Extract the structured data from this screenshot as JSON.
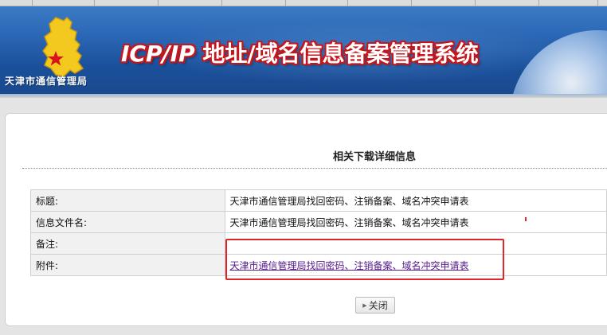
{
  "header": {
    "org_name": "天津市通信管理局",
    "system_title_latin": "ICP/IP",
    "system_title_rest": " 地址/域名信息备案管理系统",
    "logo_icon": "tianjin-map-star-icon",
    "accent_red": "#c4161c"
  },
  "main": {
    "heading": "相关下载详细信息",
    "rows": [
      {
        "label": "标题:",
        "value": "天津市通信管理局找回密码、注销备案、域名冲突申请表"
      },
      {
        "label": "信息文件名:",
        "value": "天津市通信管理局找回密码、注销备案、域名冲突申请表"
      },
      {
        "label": "备注:",
        "value": ""
      },
      {
        "label": "附件:",
        "value": "天津市通信管理局找回密码、注销备案、域名冲突申请表"
      }
    ],
    "close_label": "关闭",
    "close_icon": "arrow-right-icon"
  }
}
